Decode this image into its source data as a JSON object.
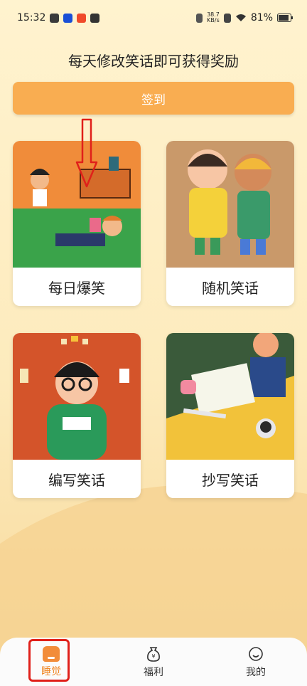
{
  "status_bar": {
    "time": "15:32",
    "speed_top": "38.7",
    "speed_bottom": "KB/s",
    "battery": "81%"
  },
  "header": {
    "title": "每天修改笑话即可获得奖励"
  },
  "checkin": {
    "label": "签到"
  },
  "cards": [
    {
      "label": "每日爆笑"
    },
    {
      "label": "随机笑话"
    },
    {
      "label": "编写笑话"
    },
    {
      "label": "抄写笑话"
    }
  ],
  "nav": {
    "items": [
      {
        "label": "睡觉",
        "icon": "home-icon",
        "active": true
      },
      {
        "label": "福利",
        "icon": "money-bag-icon",
        "active": false
      },
      {
        "label": "我的",
        "icon": "profile-icon",
        "active": false
      }
    ]
  },
  "colors": {
    "accent": "#f9ad51",
    "active_nav": "#f08a2a",
    "highlight": "#e0201a"
  }
}
